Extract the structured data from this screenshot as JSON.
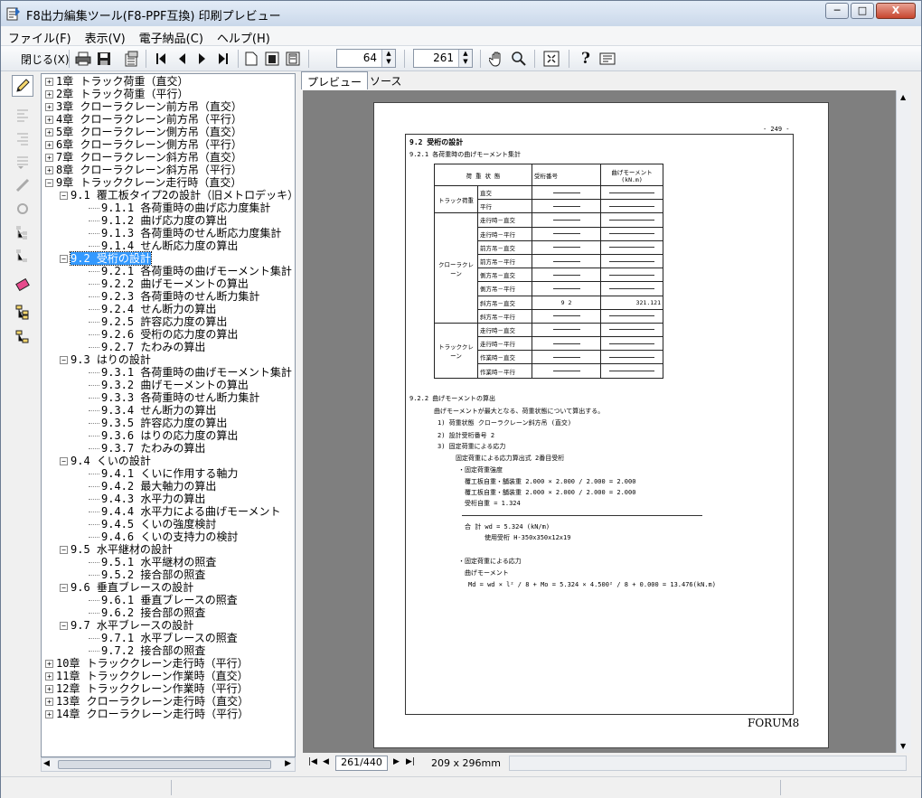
{
  "window": {
    "title": "F8出力編集ツール(F8-PPF互換) 印刷プレビュー",
    "minimize": "─",
    "maximize": "□",
    "close": "X"
  },
  "menu": [
    {
      "label": "ファイル(F)"
    },
    {
      "label": "表示(V)"
    },
    {
      "label": "電子納品(C)"
    },
    {
      "label": "ヘルプ(H)"
    }
  ],
  "toolbar": {
    "close_label": "閉じる(X)",
    "zoom_value": "64",
    "page_value": "261"
  },
  "tree": {
    "items": [
      {
        "label": "1章 トラック荷重（直交）",
        "level": 0,
        "expander": "+"
      },
      {
        "label": "2章 トラック荷重（平行）",
        "level": 0,
        "expander": "+"
      },
      {
        "label": "3章 クローラクレーン前方吊（直交）",
        "level": 0,
        "expander": "+"
      },
      {
        "label": "4章 クローラクレーン前方吊（平行）",
        "level": 0,
        "expander": "+"
      },
      {
        "label": "5章 クローラクレーン側方吊（直交）",
        "level": 0,
        "expander": "+"
      },
      {
        "label": "6章 クローラクレーン側方吊（平行）",
        "level": 0,
        "expander": "+"
      },
      {
        "label": "7章 クローラクレーン斜方吊（直交）",
        "level": 0,
        "expander": "+"
      },
      {
        "label": "8章 クローラクレーン斜方吊（平行）",
        "level": 0,
        "expander": "+"
      },
      {
        "label": "9章 トラッククレーン走行時（直交）",
        "level": 0,
        "expander": "−"
      },
      {
        "label": "9.1 覆工板タイプ2の設計（旧メトロデッキ）",
        "level": 1,
        "expander": "−"
      },
      {
        "label": "9.1.1 各荷重時の曲げ応力度集計",
        "level": 2,
        "expander": ""
      },
      {
        "label": "9.1.2 曲げ応力度の算出",
        "level": 2,
        "expander": ""
      },
      {
        "label": "9.1.3 各荷重時のせん断応力度集計",
        "level": 2,
        "expander": ""
      },
      {
        "label": "9.1.4 せん断応力度の算出",
        "level": 2,
        "expander": ""
      },
      {
        "label": "9.2 受桁の設計",
        "level": 1,
        "expander": "−",
        "selected": true
      },
      {
        "label": "9.2.1 各荷重時の曲げモーメント集計",
        "level": 2,
        "expander": ""
      },
      {
        "label": "9.2.2 曲げモーメントの算出",
        "level": 2,
        "expander": ""
      },
      {
        "label": "9.2.3 各荷重時のせん断力集計",
        "level": 2,
        "expander": ""
      },
      {
        "label": "9.2.4 せん断力の算出",
        "level": 2,
        "expander": ""
      },
      {
        "label": "9.2.5 許容応力度の算出",
        "level": 2,
        "expander": ""
      },
      {
        "label": "9.2.6 受桁の応力度の算出",
        "level": 2,
        "expander": ""
      },
      {
        "label": "9.2.7 たわみの算出",
        "level": 2,
        "expander": ""
      },
      {
        "label": "9.3 はりの設計",
        "level": 1,
        "expander": "−"
      },
      {
        "label": "9.3.1 各荷重時の曲げモーメント集計",
        "level": 2,
        "expander": ""
      },
      {
        "label": "9.3.2 曲げモーメントの算出",
        "level": 2,
        "expander": ""
      },
      {
        "label": "9.3.3 各荷重時のせん断力集計",
        "level": 2,
        "expander": ""
      },
      {
        "label": "9.3.4 せん断力の算出",
        "level": 2,
        "expander": ""
      },
      {
        "label": "9.3.5 許容応力度の算出",
        "level": 2,
        "expander": ""
      },
      {
        "label": "9.3.6 はりの応力度の算出",
        "level": 2,
        "expander": ""
      },
      {
        "label": "9.3.7 たわみの算出",
        "level": 2,
        "expander": ""
      },
      {
        "label": "9.4 くいの設計",
        "level": 1,
        "expander": "−"
      },
      {
        "label": "9.4.1 くいに作用する軸力",
        "level": 2,
        "expander": ""
      },
      {
        "label": "9.4.2 最大軸力の算出",
        "level": 2,
        "expander": ""
      },
      {
        "label": "9.4.3 水平力の算出",
        "level": 2,
        "expander": ""
      },
      {
        "label": "9.4.4 水平力による曲げモーメント",
        "level": 2,
        "expander": ""
      },
      {
        "label": "9.4.5 くいの強度検討",
        "level": 2,
        "expander": ""
      },
      {
        "label": "9.4.6 くいの支持力の検討",
        "level": 2,
        "expander": ""
      },
      {
        "label": "9.5 水平継材の設計",
        "level": 1,
        "expander": "−"
      },
      {
        "label": "9.5.1 水平継材の照査",
        "level": 2,
        "expander": ""
      },
      {
        "label": "9.5.2 接合部の照査",
        "level": 2,
        "expander": ""
      },
      {
        "label": "9.6 垂直ブレースの設計",
        "level": 1,
        "expander": "−"
      },
      {
        "label": "9.6.1 垂直ブレースの照査",
        "level": 2,
        "expander": ""
      },
      {
        "label": "9.6.2 接合部の照査",
        "level": 2,
        "expander": ""
      },
      {
        "label": "9.7 水平ブレースの設計",
        "level": 1,
        "expander": "−"
      },
      {
        "label": "9.7.1 水平ブレースの照査",
        "level": 2,
        "expander": ""
      },
      {
        "label": "9.7.2 接合部の照査",
        "level": 2,
        "expander": ""
      },
      {
        "label": "10章 トラッククレーン走行時（平行）",
        "level": 0,
        "expander": "+"
      },
      {
        "label": "11章 トラッククレーン作業時（直交）",
        "level": 0,
        "expander": "+"
      },
      {
        "label": "12章 トラッククレーン作業時（平行）",
        "level": 0,
        "expander": "+"
      },
      {
        "label": "13章 クローラクレーン走行時（直交）",
        "level": 0,
        "expander": "+"
      },
      {
        "label": "14章 クローラクレーン走行時（平行）",
        "level": 0,
        "expander": "+"
      }
    ]
  },
  "tabs": [
    {
      "label": "プレビュー",
      "active": true
    },
    {
      "label": "ソース",
      "active": false
    }
  ],
  "pager": {
    "page_indicator": "261/440",
    "paper_size": "209 x 296mm"
  },
  "document": {
    "page_number": "- 249 -",
    "section_title": "9.2 受桁の設計",
    "subsection_1": "9.2.1 各荷重時の曲げモーメント集計",
    "table": {
      "headers": [
        "荷  重  状  態",
        "受桁番号",
        "曲げモーメント (kN.m)"
      ],
      "groups": [
        {
          "name": "トラック荷重",
          "rows": [
            {
              "state": "直交",
              "num": "",
              "val": ""
            },
            {
              "state": "平行",
              "num": "",
              "val": ""
            }
          ]
        },
        {
          "name": "クローラクレーン",
          "rows": [
            {
              "state": "走行時－直交",
              "num": "",
              "val": ""
            },
            {
              "state": "走行時－平行",
              "num": "",
              "val": ""
            },
            {
              "state": "前方吊－直交",
              "num": "",
              "val": ""
            },
            {
              "state": "前方吊－平行",
              "num": "",
              "val": ""
            },
            {
              "state": "側方吊－直交",
              "num": "",
              "val": ""
            },
            {
              "state": "側方吊－平行",
              "num": "",
              "val": ""
            },
            {
              "state": "斜方吊－直交",
              "num": "9  2",
              "val": "321.121"
            },
            {
              "state": "斜方吊－平行",
              "num": "",
              "val": ""
            }
          ]
        },
        {
          "name": "トラッククレーン",
          "rows": [
            {
              "state": "走行時－直交",
              "num": "",
              "val": ""
            },
            {
              "state": "走行時－平行",
              "num": "",
              "val": ""
            },
            {
              "state": "作業時－直交",
              "num": "",
              "val": ""
            },
            {
              "state": "作業時－平行",
              "num": "",
              "val": ""
            }
          ]
        }
      ]
    },
    "subsection_2": "9.2.2 曲げモーメントの算出",
    "text_lines": [
      "曲げモーメントが最大となる、荷重状態について算出する。",
      "1) 荷重状態       クローラクレーン斜方吊 (直交)",
      "2) 設計受桁番号     2",
      "3) 固定荷重による応力",
      "固定荷重による応力算出式     2番目受桁",
      "・固定荷重強度",
      "覆工板自重・舗装重       2.000  ×   2.000  /    2.000  =     2.000",
      "覆工板自重・舗装重       2.000  ×   2.000  /    2.000  =     2.000",
      "受桁自重                                           =     1.324",
      "合   計                                   wd   =     5.324 (kN/m)",
      "使用受桁       H-350x350x12x19",
      "・固定荷重による応力",
      "曲げモーメント",
      "Md = wd × l² / 8 + Mo =    5.324 ×    4.500² / 8 + 0.000  = 13.476(kN.m)"
    ],
    "footer_logo": "FORUM8"
  },
  "icons": {
    "pencil": "pencil-icon",
    "hand": "hand-icon",
    "zoom": "magnifier-icon",
    "help": "help-icon"
  }
}
